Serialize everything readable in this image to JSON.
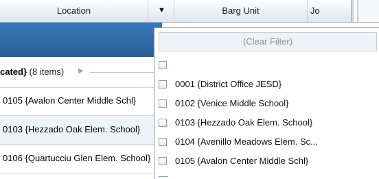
{
  "header": {
    "location_label": "Location",
    "dropdown_icon": "▼",
    "barg_unit_label": "Barg Unit",
    "jo_label": "Jo"
  },
  "group": {
    "title_bold": "cated}",
    "count_text": " (8 items)",
    "expand_icon": "▶"
  },
  "rows": [
    {
      "text": "0105 {Avalon Center Middle Schl}"
    },
    {
      "text": "0103 {Hezzado Oak Elem. School}"
    },
    {
      "text": "0106 {Quartucciu Glen Elem. School}"
    }
  ],
  "filter": {
    "clear_label": "(Clear Filter)",
    "items": [
      {
        "label": ""
      },
      {
        "label": "0001 {District Office JESD}"
      },
      {
        "label": "0102 {Venice Middle School}"
      },
      {
        "label": "0103 {Hezzado Oak Elem. School}"
      },
      {
        "label": "0104 {Avenillo Meadows Elem. Sc..."
      },
      {
        "label": "0105 {Avalon Center Middle Schl}"
      }
    ]
  },
  "colors": {
    "group_band": "#2e6aa6",
    "alt_row": "#eef3fa",
    "header_gradient_bottom": "#dfe6ef"
  }
}
